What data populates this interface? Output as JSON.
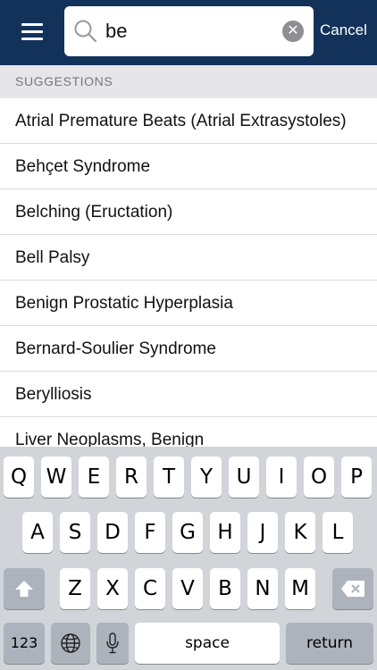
{
  "header": {
    "menu_icon": "hamburger-menu-icon",
    "search": {
      "value": "be",
      "placeholder": ""
    },
    "cancel_label": "Cancel",
    "colors": {
      "bar": "#13325a",
      "text": "#ffffff"
    }
  },
  "suggestions": {
    "header": "SUGGESTIONS",
    "items": [
      "Atrial Premature Beats (Atrial Extrasystoles)",
      "Behçet Syndrome",
      "Belching (Eructation)",
      "Bell Palsy",
      "Benign Prostatic Hyperplasia",
      "Bernard-Soulier Syndrome",
      "Berylliosis",
      "Liver Neoplasms, Benign"
    ]
  },
  "keyboard": {
    "row1": [
      "Q",
      "W",
      "E",
      "R",
      "T",
      "Y",
      "U",
      "I",
      "O",
      "P"
    ],
    "row2": [
      "A",
      "S",
      "D",
      "F",
      "G",
      "H",
      "J",
      "K",
      "L"
    ],
    "row3": [
      "Z",
      "X",
      "C",
      "V",
      "B",
      "N",
      "M"
    ],
    "numbers_label": "123",
    "space_label": "space",
    "return_label": "return",
    "icons": {
      "shift": "shift-icon",
      "delete": "backspace-icon",
      "globe": "globe-icon",
      "mic": "microphone-icon"
    }
  }
}
